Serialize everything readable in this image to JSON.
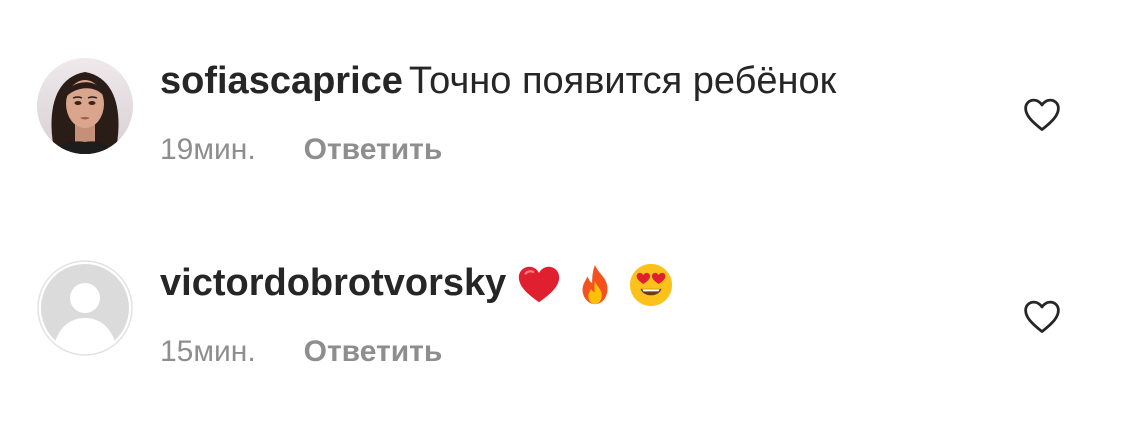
{
  "comments": [
    {
      "username": "sofiascaprice",
      "text": "Точно появится ребёнок",
      "time": "19мин.",
      "reply_label": "Ответить",
      "avatar": "profile-photo",
      "like_icon": "heart-outline-icon"
    },
    {
      "username": "victordobrotvorsky",
      "text": "",
      "emojis": [
        "red-heart-emoji",
        "fire-emoji",
        "heart-eyes-emoji"
      ],
      "time": "15мин.",
      "reply_label": "Ответить",
      "avatar": "default-avatar",
      "like_icon": "heart-outline-icon"
    }
  ],
  "colors": {
    "text": "#262626",
    "secondary": "#8e8e8e",
    "default_avatar_bg": "#dbdbdb"
  }
}
